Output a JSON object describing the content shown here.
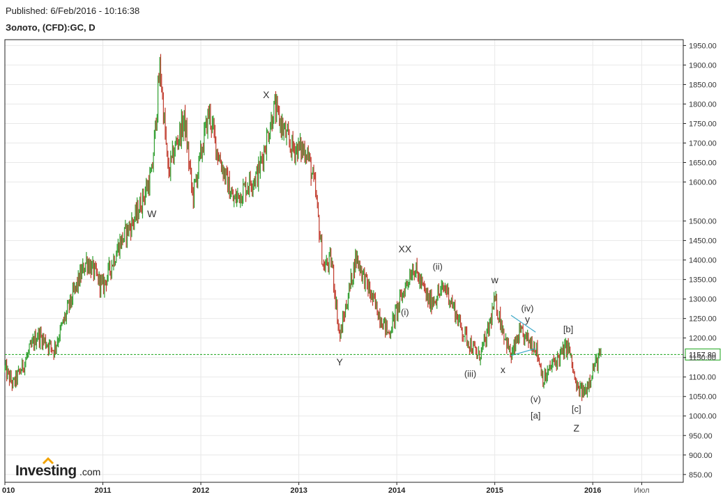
{
  "header": {
    "published": "Published: 6/Feb/2016 - 10:16:38",
    "instrument": "Золото, (CFD):GC, D"
  },
  "branding": {
    "logo_main": "Investing",
    "logo_suffix": ".com"
  },
  "chart_data": {
    "type": "candlestick",
    "title": "Золото, (CFD):GC, D",
    "xlabel": "",
    "ylabel": "",
    "grid": true,
    "ylim": [
      830,
      1965
    ],
    "x_range": [
      "2010-01",
      "2016-12"
    ],
    "y_ticks": [
      "850.00",
      "900.00",
      "950.00",
      "1000.00",
      "1050.00",
      "1100.00",
      "1150.00",
      "1200.00",
      "1250.00",
      "1300.00",
      "1350.00",
      "1400.00",
      "1450.00",
      "1500.00",
      "1600.00",
      "1650.00",
      "1700.00",
      "1750.00",
      "1800.00",
      "1850.00",
      "1900.00",
      "1950.00"
    ],
    "x_ticks": [
      {
        "label": "010",
        "date": "2010-01"
      },
      {
        "label": "2011",
        "date": "2011-01"
      },
      {
        "label": "2012",
        "date": "2012-01"
      },
      {
        "label": "2013",
        "date": "2013-01"
      },
      {
        "label": "2014",
        "date": "2014-01"
      },
      {
        "label": "2015",
        "date": "2015-01"
      },
      {
        "label": "2016",
        "date": "2016-01"
      },
      {
        "label": "Июл",
        "date": "2016-07"
      }
    ],
    "current_price": {
      "value": 1157.8,
      "label": "1157.80"
    },
    "colors": {
      "up": "#2e9e2e",
      "down": "#c0392b",
      "price_line": "#17a317",
      "grid": "#e8e8e8",
      "trendline": "#3aa8c8"
    },
    "price_series": [
      {
        "date": "2010-01",
        "price": 1120
      },
      {
        "date": "2010-02",
        "price": 1080
      },
      {
        "date": "2010-03",
        "price": 1120
      },
      {
        "date": "2010-05",
        "price": 1210
      },
      {
        "date": "2010-07",
        "price": 1170
      },
      {
        "date": "2010-09",
        "price": 1290
      },
      {
        "date": "2010-11",
        "price": 1400
      },
      {
        "date": "2011-01",
        "price": 1330
      },
      {
        "date": "2011-03",
        "price": 1440
      },
      {
        "date": "2011-05",
        "price": 1510
      },
      {
        "date": "2011-07",
        "price": 1620
      },
      {
        "date": "2011-08",
        "price": 1900
      },
      {
        "date": "2011-09",
        "price": 1620
      },
      {
        "date": "2011-10",
        "price": 1700
      },
      {
        "date": "2011-11",
        "price": 1760
      },
      {
        "date": "2011-12",
        "price": 1560
      },
      {
        "date": "2012-02",
        "price": 1780
      },
      {
        "date": "2012-03",
        "price": 1680
      },
      {
        "date": "2012-05",
        "price": 1550
      },
      {
        "date": "2012-07",
        "price": 1600
      },
      {
        "date": "2012-08",
        "price": 1620
      },
      {
        "date": "2012-10",
        "price": 1790
      },
      {
        "date": "2012-12",
        "price": 1690
      },
      {
        "date": "2013-02",
        "price": 1680
      },
      {
        "date": "2013-03",
        "price": 1580
      },
      {
        "date": "2013-04",
        "price": 1380
      },
      {
        "date": "2013-05",
        "price": 1400
      },
      {
        "date": "2013-06",
        "price": 1200
      },
      {
        "date": "2013-08",
        "price": 1410
      },
      {
        "date": "2013-10",
        "price": 1300
      },
      {
        "date": "2013-12",
        "price": 1210
      },
      {
        "date": "2014-02",
        "price": 1330
      },
      {
        "date": "2014-03",
        "price": 1385
      },
      {
        "date": "2014-05",
        "price": 1290
      },
      {
        "date": "2014-07",
        "price": 1330
      },
      {
        "date": "2014-09",
        "price": 1220
      },
      {
        "date": "2014-11",
        "price": 1150
      },
      {
        "date": "2014-12",
        "price": 1200
      },
      {
        "date": "2015-01",
        "price": 1295
      },
      {
        "date": "2015-03",
        "price": 1150
      },
      {
        "date": "2015-04",
        "price": 1210
      },
      {
        "date": "2015-06",
        "price": 1180
      },
      {
        "date": "2015-07",
        "price": 1090
      },
      {
        "date": "2015-08",
        "price": 1130
      },
      {
        "date": "2015-10",
        "price": 1180
      },
      {
        "date": "2015-11",
        "price": 1070
      },
      {
        "date": "2015-12",
        "price": 1060
      },
      {
        "date": "2016-01",
        "price": 1120
      },
      {
        "date": "2016-02",
        "price": 1158
      }
    ],
    "annotations": [
      {
        "text": "W",
        "date": "2011-07",
        "price": 1510,
        "size": "big"
      },
      {
        "text": "X",
        "date": "2012-09",
        "price": 1815,
        "size": "big"
      },
      {
        "text": "Y",
        "date": "2013-06",
        "price": 1130,
        "size": "big"
      },
      {
        "text": "XX",
        "date": "2014-02",
        "price": 1420,
        "size": "big"
      },
      {
        "text": "(i)",
        "date": "2014-02",
        "price": 1258,
        "size": "small"
      },
      {
        "text": "(ii)",
        "date": "2014-06",
        "price": 1375,
        "size": "small"
      },
      {
        "text": "w",
        "date": "2015-01",
        "price": 1340,
        "size": "big"
      },
      {
        "text": "(iii)",
        "date": "2014-10",
        "price": 1100,
        "size": "small"
      },
      {
        "text": "x",
        "date": "2015-02",
        "price": 1110,
        "size": "big"
      },
      {
        "text": "(iv)",
        "date": "2015-05",
        "price": 1268,
        "size": "small"
      },
      {
        "text": "y",
        "date": "2015-05",
        "price": 1240,
        "size": "big"
      },
      {
        "text": "[b]",
        "date": "2015-10",
        "price": 1215,
        "size": "small"
      },
      {
        "text": "(v)",
        "date": "2015-06",
        "price": 1035,
        "size": "small"
      },
      {
        "text": "[a]",
        "date": "2015-06",
        "price": 993,
        "size": "small"
      },
      {
        "text": "[c]",
        "date": "2015-11",
        "price": 1010,
        "size": "small"
      },
      {
        "text": "Z",
        "date": "2015-11",
        "price": 960,
        "size": "big"
      }
    ],
    "trendlines": [
      {
        "from": {
          "date": "2015-03",
          "price": 1258
        },
        "to": {
          "date": "2015-06",
          "price": 1215
        }
      },
      {
        "from": {
          "date": "2015-03",
          "price": 1155
        },
        "to": {
          "date": "2015-06",
          "price": 1173
        }
      }
    ]
  }
}
